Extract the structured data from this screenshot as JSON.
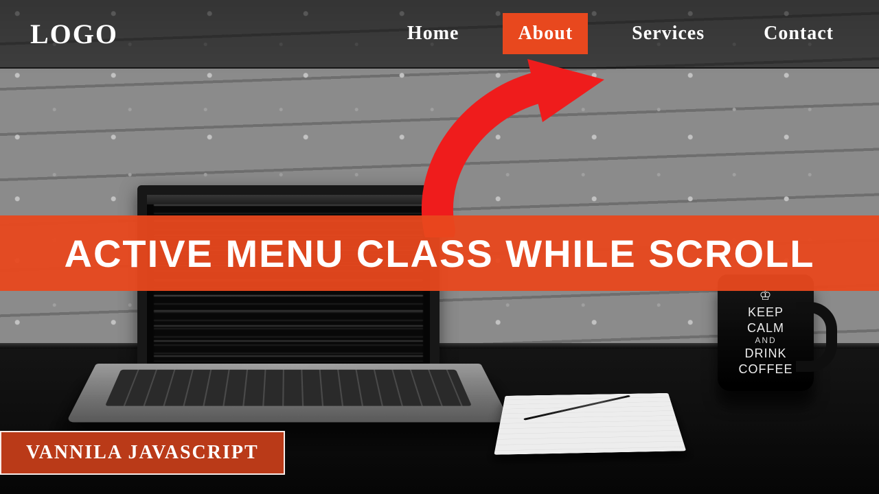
{
  "colors": {
    "accent": "#e8481e",
    "overlay": "rgba(0,0,0,.55)",
    "text": "#ffffff"
  },
  "header": {
    "logo": "LOGO",
    "nav": [
      {
        "id": "home",
        "label": "Home",
        "active": false
      },
      {
        "id": "about",
        "label": "About",
        "active": true
      },
      {
        "id": "services",
        "label": "Services",
        "active": false
      },
      {
        "id": "contact",
        "label": "Contact",
        "active": false
      }
    ]
  },
  "arrow": {
    "icon": "curved-arrow-up-right"
  },
  "title": "ACTIVE MENU CLASS WHILE SCROLL",
  "tag": "VANNILA JAVASCRIPT",
  "mug": {
    "crown": "♔",
    "line1": "KEEP",
    "line2": "CALM",
    "and": "AND",
    "line3": "DRINK",
    "line4": "COFFEE"
  }
}
